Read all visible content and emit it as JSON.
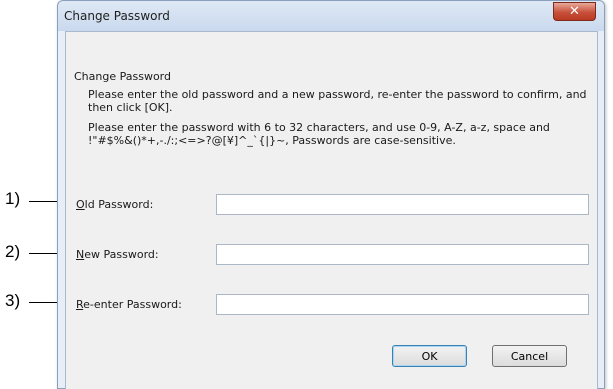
{
  "dialog": {
    "title": "Change Password",
    "close_icon": "close-icon"
  },
  "content": {
    "heading": "Change Password",
    "instruction": "Please enter the old password and a new password, re-enter the password to confirm, and then click [OK].",
    "rules": "Please enter the password with 6 to 32 characters, and use 0-9, A-Z, a-z, space and !\"#$%&()*+,-./:;<=>?@[¥]^_`{|}~, Passwords are case-sensitive."
  },
  "fields": [
    {
      "callout": "1)",
      "label_mnemonic": "O",
      "label_rest": "ld Password:",
      "value": ""
    },
    {
      "callout": "2)",
      "label_mnemonic": "N",
      "label_rest": "ew Password:",
      "value": ""
    },
    {
      "callout": "3)",
      "label_mnemonic": "R",
      "label_rest": "e-enter Password:",
      "value": ""
    }
  ],
  "buttons": {
    "ok": "OK",
    "cancel": "Cancel"
  }
}
